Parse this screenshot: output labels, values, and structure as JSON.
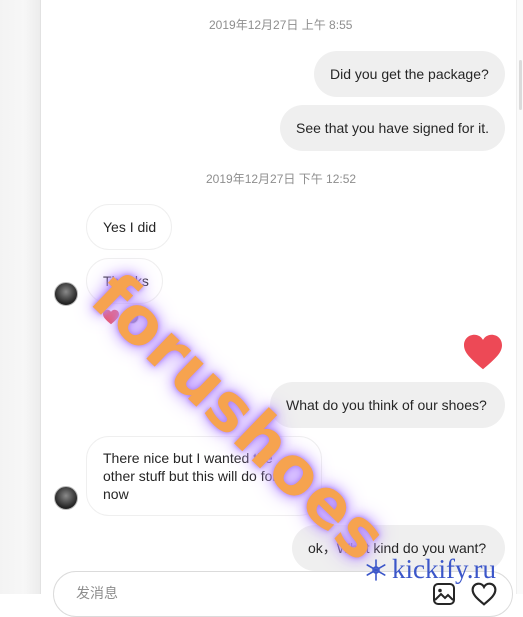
{
  "timestamps": {
    "first": "2019年12月27日 上午 8:55",
    "second": "2019年12月27日 下午 12:52"
  },
  "messages": {
    "m1": "Did you get the package?",
    "m2": "See that you have signed for it.",
    "m3": "Yes I did",
    "m4": "Thanks",
    "m5": "What do you think of our shoes?",
    "m6": "There nice but I wanted the other stuff but this will do for now",
    "m7": "ok，What kind do you want?"
  },
  "reactions": {
    "icons": [
      "heart-icon",
      "reactor-avatar"
    ]
  },
  "sent_reaction": {
    "icon": "heart-icon"
  },
  "composer": {
    "placeholder": "发消息",
    "icons": [
      "image-icon",
      "heart-icon"
    ]
  },
  "watermark": {
    "text": "forushoes"
  },
  "brand": {
    "text": "kickify.ru",
    "icon": "snowflake-icon"
  },
  "colors": {
    "heart": "#ed4956",
    "brand": "#3b56c9",
    "watermark": "#f6a34f"
  }
}
